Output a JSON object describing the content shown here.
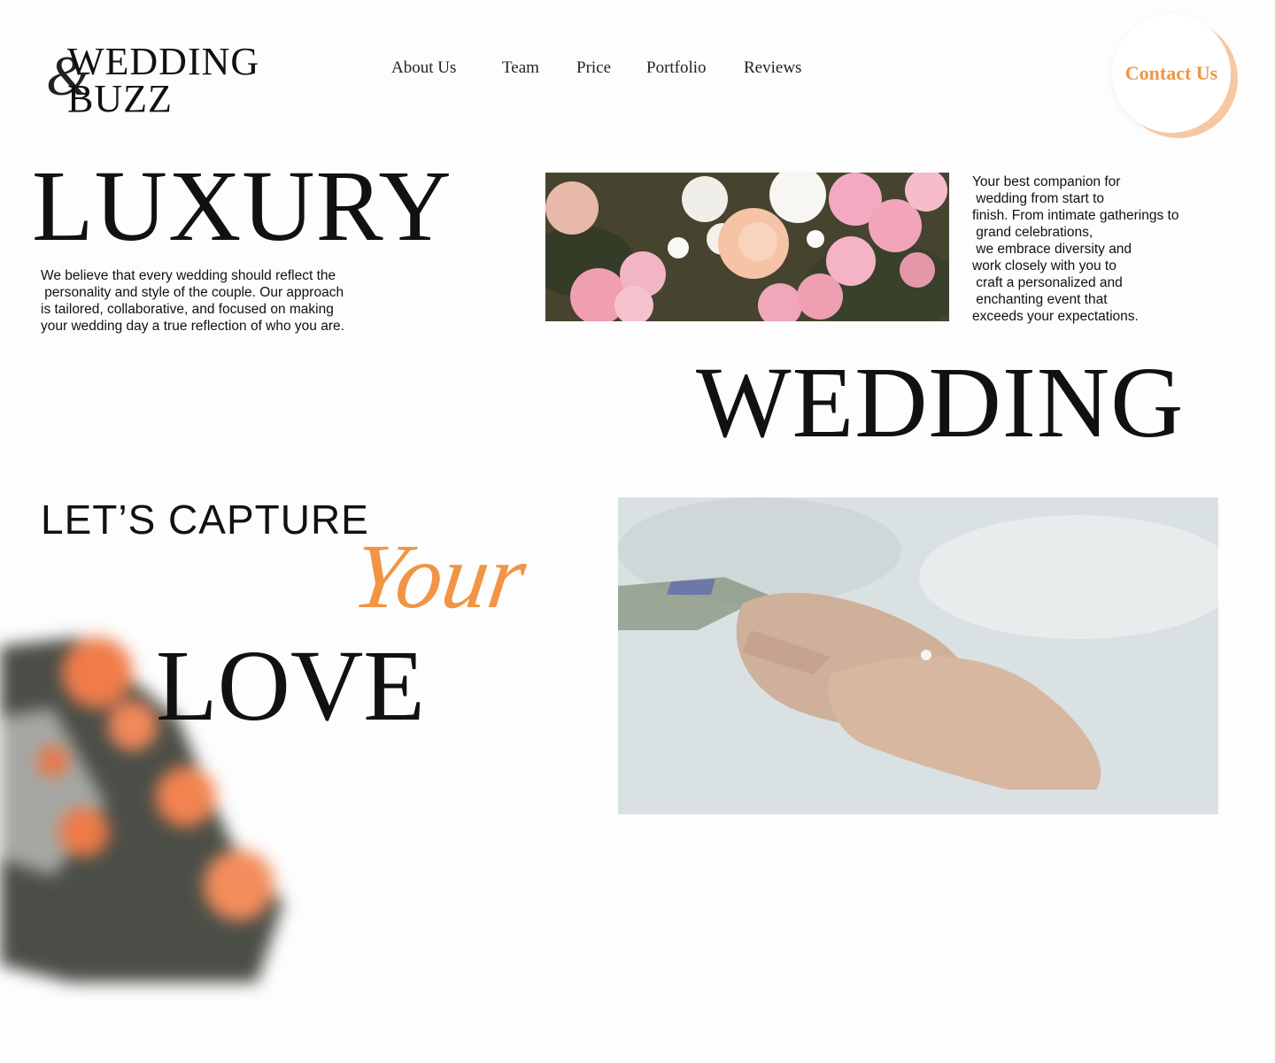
{
  "logo": {
    "amp": "&",
    "line1": "WEDDING",
    "line2": "BUZZ"
  },
  "nav": [
    "About Us",
    "Team",
    "Price",
    "Portfolio",
    "Reviews"
  ],
  "contact": {
    "label": "Contact Us"
  },
  "hero": {
    "word1": "LUXURY",
    "word2": "WEDDING",
    "paragraph_left": "We believe that every wedding should reflect the\n personality and style of the couple. Our approach\nis tailored, collaborative, and focused on making\nyour wedding day a true reflection of who you are.",
    "paragraph_right": "Your best companion for\n wedding from start to\nfinish. From intimate gatherings to\n grand celebrations,\n we embrace diversity and\nwork closely with you to\n craft a personalized and\n enchanting event that\nexceeds your expectations."
  },
  "capture": {
    "line1": "LET’S CAPTURE",
    "script": "Your",
    "line2": "LOVE"
  },
  "colors": {
    "accent": "#f09545",
    "text": "#111111",
    "background": "#fdfdfd"
  }
}
